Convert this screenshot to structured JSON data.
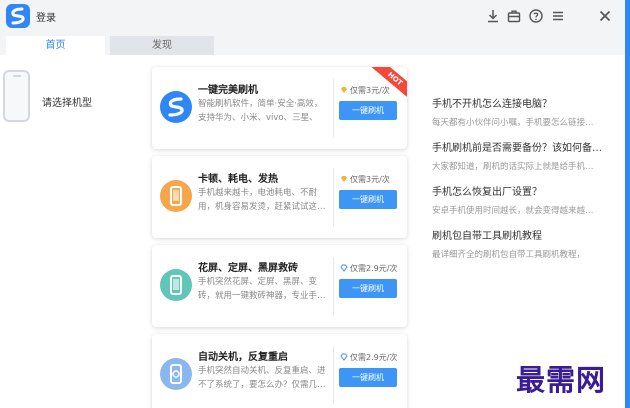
{
  "window": {
    "title": "登录",
    "controls": [
      "download-icon",
      "toolbox-icon",
      "help-icon",
      "menu-icon",
      "close-icon"
    ]
  },
  "tabs": [
    {
      "label": "首页",
      "active": true
    },
    {
      "label": "发现",
      "active": false
    }
  ],
  "sidebar": {
    "select_model_label": "请选择机型"
  },
  "cards": [
    {
      "icon": "flash-logo-icon",
      "title": "一键完美刷机",
      "desc": "智能刷机软件，简单·安全·高效，支持华为、小米、vivo、三星、乐…",
      "price": "仅需3元/次",
      "price_icon": "diamond-gold-icon",
      "button": "一键刷机",
      "badge": "HOT",
      "icon_color": "#2f86f6"
    },
    {
      "icon": "phone-orange-icon",
      "title": "卡顿、耗电、发热",
      "desc": "手机越来越卡，电池耗电、不耐用，机身容易发烫，赶紧试试这…",
      "price": "仅需3元/次",
      "price_icon": "diamond-gold-icon",
      "button": "一键刷机",
      "icon_color": "#f7a64b"
    },
    {
      "icon": "phone-teal-icon",
      "title": "花屏、定屏、黑屏救砖",
      "desc": "手机突然花屏、定屏、黑屏、变砖，就用一键救砖神器，专业手…",
      "price": "仅需2.9元/次",
      "price_icon": "diamond-blue-icon",
      "button": "一键刷机",
      "icon_color": "#5fc6b8"
    },
    {
      "icon": "phone-blue-icon",
      "title": "自动关机，反复重启",
      "desc": "手机突然自动关机、反复重启、进不了系统了，要怎么办？仅需几…",
      "price": "仅需2.9元/次",
      "price_icon": "diamond-blue-icon",
      "button": "一键刷机",
      "icon_color": "#8ab8ee"
    }
  ],
  "faq": [
    {
      "q": "手机不开机怎么连接电脑？",
      "a": "每天都有小伙伴问小嘱，手机要怎么链接…"
    },
    {
      "q": "手机刷机前是否需要备份？该如何备…",
      "a": "大家都知道，刷机的话实际上就是给手机…"
    },
    {
      "q": "手机怎么恢复出厂设置？",
      "a": "安卓手机使用时间越长，就会变得越来越…"
    },
    {
      "q": "刷机包自带工具刷机教程",
      "a": "最详细齐全的刷机包自带工具刷机教程，"
    }
  ],
  "watermark": "最需网",
  "colors": {
    "accent": "#2f86f6",
    "button": "#3d95f6",
    "hot": "#f3483b",
    "gold": "#f2b534"
  }
}
